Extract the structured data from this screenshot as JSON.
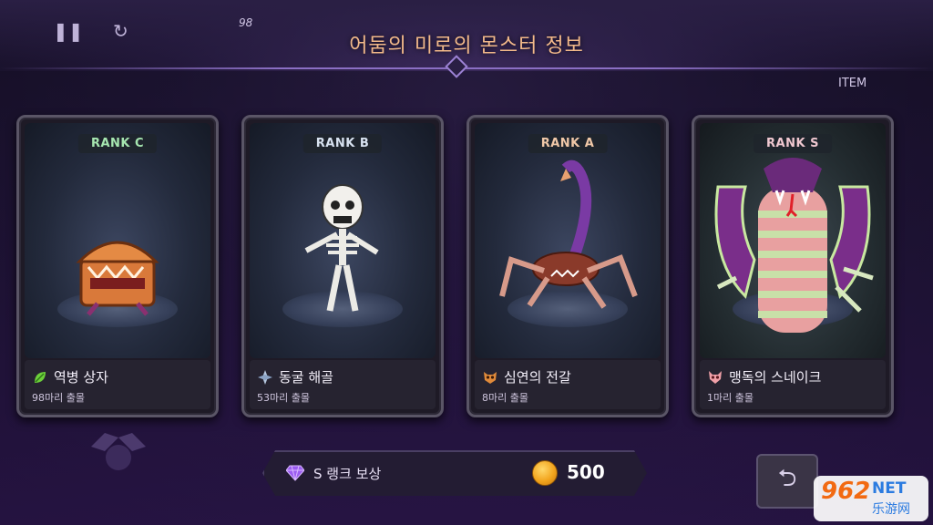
{
  "hud": {
    "count": "98",
    "item_label": "ITEM"
  },
  "title": "어둠의 미로의 몬스터 정보",
  "cards": [
    {
      "rank": "RANK C",
      "name": "역병 상자",
      "count": "98마리 출몰",
      "icon": "leaf-icon",
      "monster": "mimic-chest"
    },
    {
      "rank": "RANK B",
      "name": "동굴 해골",
      "count": "53마리 출몰",
      "icon": "crystal-icon",
      "monster": "skeleton"
    },
    {
      "rank": "RANK A",
      "name": "심연의 전갈",
      "count": "8마리 출몰",
      "icon": "beast-skull-icon",
      "monster": "scorpion"
    },
    {
      "rank": "RANK S",
      "name": "맹독의 스네이크",
      "count": "1마리 출몰",
      "icon": "horned-skull-icon",
      "monster": "cobra"
    }
  ],
  "reward": {
    "label": "S 랭크 보상",
    "value": "500",
    "gem_color": "#9b5cf0",
    "coin_color": "#f2a51e"
  },
  "watermark": {
    "logo": "962",
    "net": "NET",
    "sub": "乐游网"
  },
  "colors": {
    "title": "#f2b98a",
    "rank_c": "#a6e6b0"
  }
}
